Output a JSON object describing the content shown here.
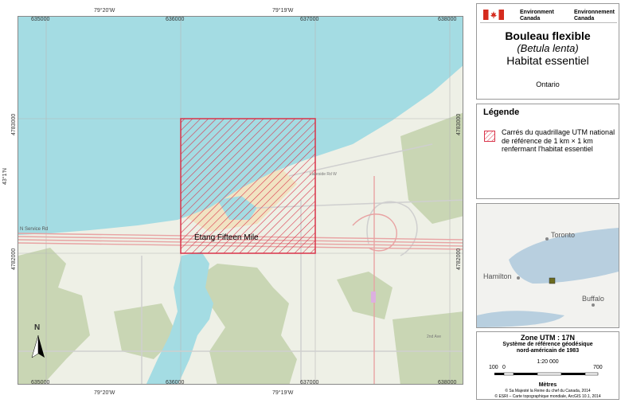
{
  "map": {
    "top_longitudes": [
      "79°20'W",
      "79°19'W"
    ],
    "bottom_longitudes": [
      "79°20'W",
      "79°19'W"
    ],
    "top_eastings": [
      "635000",
      "636000",
      "637000",
      "638000"
    ],
    "bottom_eastings": [
      "635000",
      "636000",
      "637000",
      "638000"
    ],
    "left_northings": [
      "4783000",
      "4782000"
    ],
    "right_northings": [
      "4783000",
      "4782000"
    ],
    "left_latitude": "43°1'N",
    "place_labels": {
      "pond": "Étang Fifteen Mile",
      "service_rd": "N Service Rd",
      "fifteen_mile": "Fifteen Mile Ck",
      "lakeside": "Lakeside Rd W",
      "seventh": "7th St Louth",
      "third": "3rd Ave",
      "ninth": "Ninth St",
      "second": "2nd Ave",
      "seventeen": "Seventeen Mile",
      "cherry": "Cherry Ave",
      "fourth": "4th Ave",
      "forty": "40 Mile Rd"
    },
    "north_arrow_label": "N"
  },
  "colors": {
    "water": "#a4dce3",
    "land": "#eef0e6",
    "forest": "#c9d6b4",
    "habitat": "#d9344a",
    "road_major": "#e8a3a3",
    "road_minor": "#d4d4d4",
    "urban": "#f1e3c2"
  },
  "panel": {
    "gov_en": "Environment\nCanada",
    "gov_fr": "Environnement\nCanada",
    "title_common": "Bouleau flexible",
    "title_latin": "(Betula lenta)",
    "title_habitat": "Habitat essentiel",
    "region": "Ontario",
    "legend_title": "Légende",
    "legend_label": "Carrés du quadrillage UTM national de référence de 1 km × 1 km renfermant l'habitat essentiel",
    "inset_labels": {
      "toronto": "Toronto",
      "hamilton": "Hamilton",
      "buffalo": "Buffalo"
    },
    "zone": "Zone UTM : 17N",
    "datum_1": "Système de référence géodésique",
    "datum_2": "nord-américain de 1983",
    "scale_ratio": "1:20 000",
    "scale_ticks": [
      "100",
      "0",
      "700"
    ],
    "scale_unit": "Mètres",
    "copyright_1": "© Sa Majesté la Reine du chef du Canada, 2014",
    "copyright_2": "© ESRI – Carte topographique mondiale, ArcGIS 10.1, 2014"
  }
}
